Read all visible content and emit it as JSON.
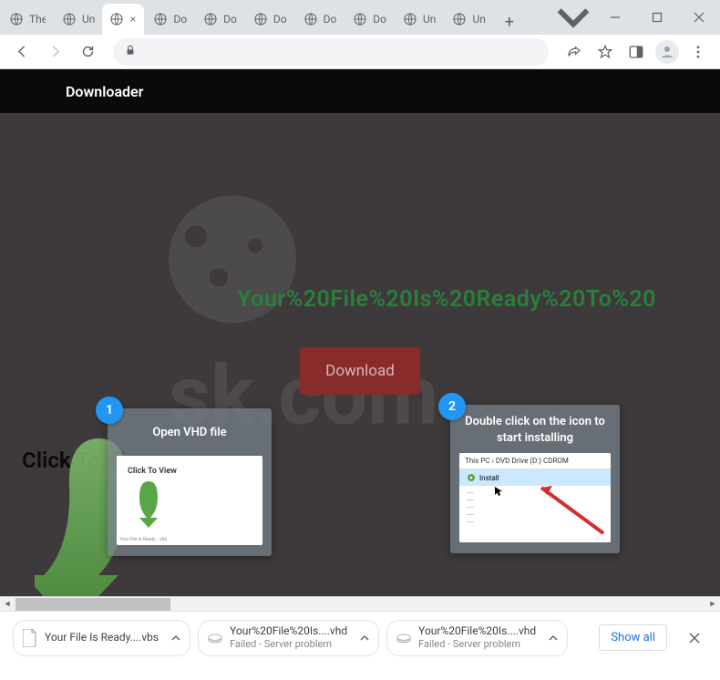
{
  "browser": {
    "tabs": [
      {
        "label": "The",
        "active": false
      },
      {
        "label": "Un",
        "active": false
      },
      {
        "label": "",
        "active": true
      },
      {
        "label": "Do",
        "active": false
      },
      {
        "label": "Do",
        "active": false
      },
      {
        "label": "Do",
        "active": false
      },
      {
        "label": "Do",
        "active": false
      },
      {
        "label": "Do",
        "active": false
      },
      {
        "label": "Un",
        "active": false
      },
      {
        "label": "Un",
        "active": false
      }
    ]
  },
  "page": {
    "app_title": "Downloader",
    "headline": "Your%20File%20Is%20Ready%20To%20",
    "download_label": "Download",
    "click_to_view": "Click To View",
    "steps": [
      {
        "num": "1",
        "title": "Open VHD file",
        "mock_label": "Click To View"
      },
      {
        "num": "2",
        "title": "Double click on the icon to start installing",
        "breadcrumb": "This PC  ›  DVD Drive (D:) CDROM",
        "item": "Install"
      }
    ]
  },
  "downloads": {
    "items": [
      {
        "name": "Your File Is Ready....vbs",
        "status": ""
      },
      {
        "name": "Your%20File%20Is....vhd",
        "status": "Failed - Server problem"
      },
      {
        "name": "Your%20File%20Is....vhd",
        "status": "Failed - Server problem"
      }
    ],
    "show_all": "Show all"
  }
}
